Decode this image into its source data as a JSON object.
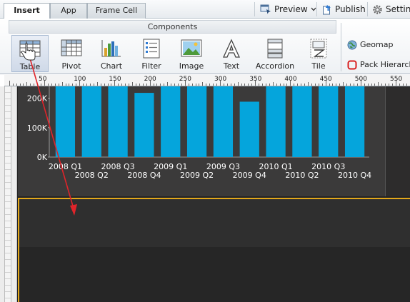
{
  "tabs": [
    {
      "label": "Insert",
      "active": true
    },
    {
      "label": "App",
      "active": false
    },
    {
      "label": "Frame Cell",
      "active": false
    }
  ],
  "toolbar": {
    "preview_label": "Preview",
    "publish_label": "Publish",
    "settings_label": "Settin"
  },
  "ribbon": {
    "group_title": "Components",
    "components": [
      {
        "label": "Table",
        "icon": "table-icon",
        "selected": true
      },
      {
        "label": "Pivot",
        "icon": "pivot-icon"
      },
      {
        "label": "Chart",
        "icon": "chart-icon"
      },
      {
        "label": "Filter",
        "icon": "filter-icon"
      },
      {
        "label": "Image",
        "icon": "image-icon"
      },
      {
        "label": "Text",
        "icon": "text-icon"
      },
      {
        "label": "Accordion",
        "icon": "accordion-icon"
      },
      {
        "label": "Tile",
        "icon": "tile-icon"
      }
    ],
    "side_items": [
      {
        "label": "Geomap",
        "icon": "globe-icon"
      },
      {
        "label": "Pack Hierarch",
        "icon": "pack-hierarchy-icon"
      }
    ]
  },
  "ruler": {
    "labels": [
      "50",
      "100",
      "150",
      "200",
      "250",
      "300",
      "350",
      "400",
      "450",
      "500",
      "550"
    ]
  },
  "colors": {
    "bar": "#05a5dc",
    "chart_bg": "#3b3a3a",
    "frame_border": "#e3a81b",
    "drag_arrow": "#e0242a"
  },
  "chart_data": {
    "type": "bar",
    "categories": [
      "2008 Q1",
      "2008 Q2",
      "2008 Q3",
      "2008 Q4",
      "2009 Q1",
      "2009 Q2",
      "2009 Q3",
      "2009 Q4",
      "2010 Q1",
      "2010 Q2",
      "2010 Q3",
      "2010 Q4"
    ],
    "values": [
      240,
      240,
      240,
      218,
      240,
      240,
      240,
      188,
      240,
      240,
      240,
      240
    ],
    "yticks": [
      "0K",
      "100K",
      "200K"
    ],
    "ylim": [
      0,
      240
    ],
    "title": "",
    "xlabel": "",
    "ylabel": ""
  }
}
